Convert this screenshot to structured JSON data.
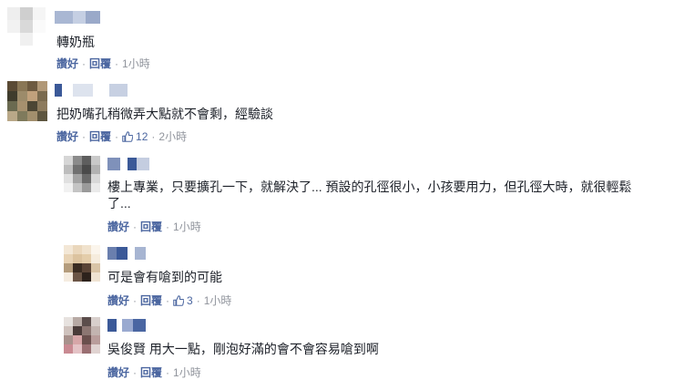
{
  "labels": {
    "like": "讚好",
    "reply": "回覆",
    "dot": "·"
  },
  "colors": {
    "link": "#4b66a0",
    "meta": "#90949c",
    "text": "#1d2129"
  },
  "comments": [
    {
      "text": "轉奶瓶",
      "time": "1小時",
      "likes": null
    },
    {
      "text": "把奶嘴孔稍微弄大點就不會剩，經驗談",
      "time": "2小時",
      "likes": "12"
    },
    {
      "text": "樓上專業，只要擴孔一下，就解決了... 預設的孔徑很小，小孩要用力，但孔徑大時，就很輕鬆了...",
      "time": "1小時",
      "likes": null
    },
    {
      "text": "可是會有嗆到的可能",
      "time": "1小時",
      "likes": "3"
    },
    {
      "text": "吳俊賢 用大一點，剛泡好滿的會不會容易嗆到啊",
      "time": "1小時",
      "likes": null
    }
  ]
}
